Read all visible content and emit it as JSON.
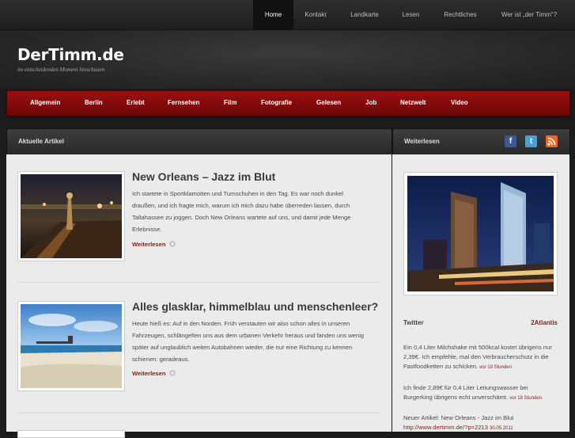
{
  "topnav": {
    "items": [
      {
        "label": "Home",
        "active": true
      },
      {
        "label": "Kontakt"
      },
      {
        "label": "Landkarte"
      },
      {
        "label": "Lesen"
      },
      {
        "label": "Rechtliches"
      },
      {
        "label": "Wer ist „der Timm“?"
      }
    ]
  },
  "header": {
    "title": "DerTimm.de",
    "tagline": "im entscheidenden Moment hinschauen"
  },
  "categories": [
    "Allgemein",
    "Berlin",
    "Erlebt",
    "Fernsehen",
    "Film",
    "Fotografie",
    "Gelesen",
    "Job",
    "Netzwelt",
    "Video"
  ],
  "main": {
    "section_title": "Aktuelle Artikel",
    "posts": [
      {
        "title": "New Orleans – Jazz im Blut",
        "lines": [
          "Ich startete in Sportklamotten und Turnschuhen in den Tag. Es war noch dunkel",
          "draußen, und ich fragte mich, warum ich mich dazu habe überreden lassen, durch",
          "Tallahassee zu joggen. Doch New Orleans wartete auf uns, und damit jede Menge",
          "Erlebnisse."
        ],
        "more": "Weiterlesen"
      },
      {
        "title": "Alles glasklar, himmelblau und menschenleer?",
        "lines": [
          "Heute hieß es: Auf in den Norden. Früh verstauten wir also schon alles in unseren",
          "Fahrzeugen, schlängelten uns aus dem urbanen Verkehr heraus und fanden uns wenig",
          "später auf unglaublich weiten Autobahnen wieder, die nur eine Richtung zu kennen",
          "schienen: geradeaus."
        ],
        "more": "Weiterlesen"
      }
    ]
  },
  "sidebar": {
    "section_title": "Weiterlesen",
    "social_icons": [
      "facebook-icon",
      "twitter-icon",
      "rss-icon"
    ],
    "twitter": {
      "heading": "Twitter",
      "account": "2Atlantis",
      "tweets": [
        {
          "text": "Ein 0,4 Liter Milchshake mit 500kcal kostet übrigens nur 2,39€. Ich empfehle, mal den Verbraucherschutz in die Fastfoodketten zu schicken.",
          "time": "vor 18 Stunden"
        },
        {
          "text": "Ich finde 2,89€ für 0,4 Liter Leitungswasser bei Burgerking übrigens echt unverschämt.",
          "time": "vor 18 Stunden"
        },
        {
          "text": "Neuer Artikel: New Orleans - Jazz im Blut",
          "link": "http://www.dertimm.de/?p=2213",
          "time": "30.05.2011"
        }
      ]
    }
  },
  "colors": {
    "accent": "#8b1a1a",
    "category_bar": "#8a0c0c",
    "facebook": "#3b5998",
    "twitter": "#4a9fd6",
    "rss": "#f26522"
  }
}
